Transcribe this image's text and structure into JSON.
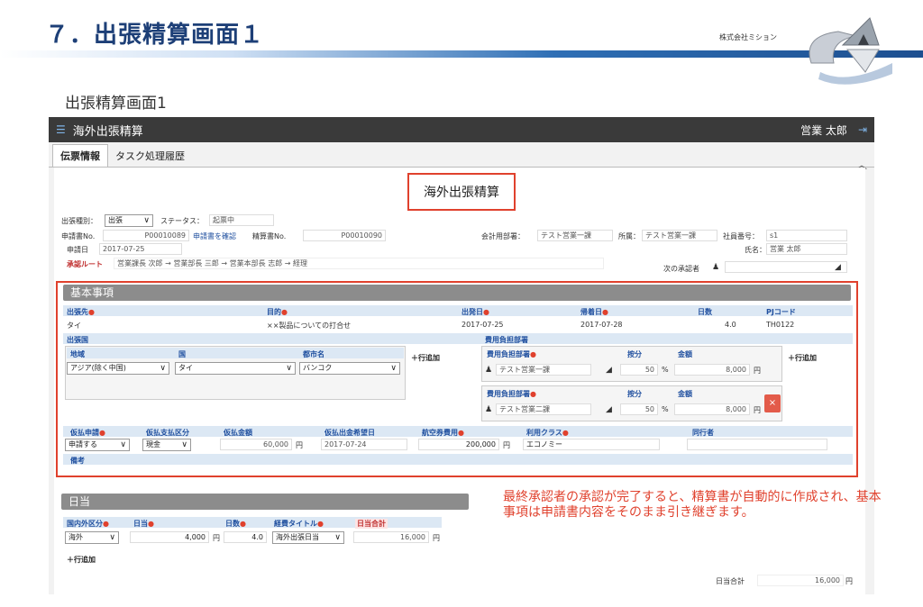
{
  "slide": {
    "title": "７．出張精算画面１",
    "company": "株式会社ミション",
    "page_title": "出張精算画面1"
  },
  "app": {
    "header_title": "海外出張精算",
    "user": "営業 太郎",
    "tabs": [
      "伝票情報",
      "タスク処理履歴"
    ],
    "doc_title": "海外出張精算"
  },
  "header_fields": {
    "trip_type_label": "出張種別：",
    "trip_type_value": "出張",
    "status_label": "ステータス：",
    "status_value": "起票中",
    "application_no_label": "申請書No.",
    "application_no_value": "P00010089",
    "application_link": "申請書を確認",
    "settlement_no_label": "精算書No.",
    "settlement_no_value": "P00010090",
    "apply_date_label": "申請日",
    "apply_date_value": "2017-07-25",
    "accounting_dept_label": "会計用部署：",
    "accounting_dept_value": "テスト営業一課",
    "affiliation_label": "所属：",
    "affiliation_value": "テスト営業一課",
    "employee_no_label": "社員番号：",
    "employee_no_value": "s1",
    "name_label": "氏名：",
    "name_value": "営業 太郎",
    "route_label": "承認ルート",
    "route_value": "営業課長 次郎 → 営業部長 三郎 → 営業本部長 志郎 → 経理",
    "next_approver_label": "次の承認者"
  },
  "basic": {
    "section_title": "基本事項",
    "destination_label": "出張先",
    "destination_value": "タイ",
    "purpose_label": "目的",
    "purpose_value": "××製品についての打合せ",
    "departure_label": "出発日",
    "departure_value": "2017-07-25",
    "return_label": "帰着日",
    "return_value": "2017-07-28",
    "days_label": "日数",
    "days_value": "4.0",
    "pj_label": "PJコード",
    "pj_value": "TH0122",
    "country_group_label": "出張国",
    "region_label": "地域",
    "country_label": "国",
    "city_label": "都市名",
    "region_value": "アジア(除く中国)",
    "country_value": "タイ",
    "city_value": "バンコク",
    "add_row": "行追加",
    "cost_dept_group_label": "費用負担部署",
    "cost_rows": [
      {
        "dept_label": "費用負担部署",
        "dept_value": "テスト営業一課",
        "ratio_label": "按分",
        "ratio_value": "50",
        "pct": "%",
        "amount_label": "金額",
        "amount_value": "8,000",
        "yen": "円"
      },
      {
        "dept_label": "費用負担部署",
        "dept_value": "テスト営業二課",
        "ratio_label": "按分",
        "ratio_value": "50",
        "pct": "%",
        "amount_label": "金額",
        "amount_value": "8,000",
        "yen": "円"
      }
    ],
    "delete_label": "×",
    "advance_label": "仮払申請",
    "advance_value": "申請する",
    "advance_type_label": "仮払支払区分",
    "advance_type_value": "現金",
    "advance_amount_label": "仮払金額",
    "advance_amount_value": "60,000",
    "yen": "円",
    "advance_date_label": "仮払出金希望日",
    "advance_date_value": "2017-07-24",
    "ticket_label": "航空券費用",
    "ticket_value": "200,000",
    "class_label": "利用クラス",
    "class_value": "エコノミー",
    "companion_label": "同行者",
    "remarks_label": "備考"
  },
  "daily": {
    "section_title": "日当",
    "domestic_label": "国内外区分",
    "domestic_value": "海外",
    "daily_label": "日当",
    "daily_value": "4,000",
    "days_label": "日数",
    "days_value": "4.0",
    "expense_title_label": "経費タイトル",
    "expense_title_value": "海外出張日当",
    "subtotal_label": "日当合計",
    "subtotal_value": "16,000",
    "yen": "円",
    "add_row": "行追加",
    "total_label": "日当合計",
    "total_value": "16,000"
  },
  "annotation": "最終承認者の承認が完了すると、精算書が自動的に作成され、基本事項は申請書内容をそのまま引き継ぎます。",
  "colors": {
    "accent_red": "#e0412d",
    "header_dark": "#3a3a3a",
    "title_blue": "#1d3f77"
  }
}
